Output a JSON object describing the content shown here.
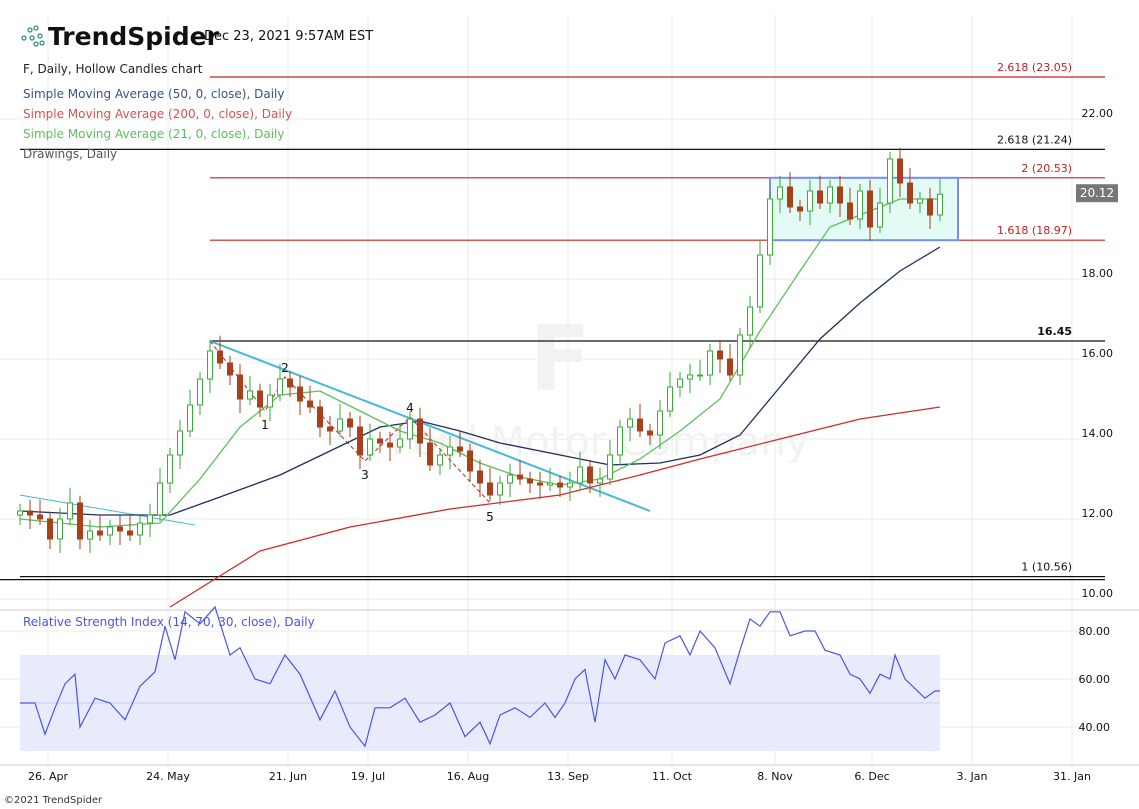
{
  "header": {
    "brand": "TrendSpider",
    "timestamp": "Dec 23, 2021 9:57AM EST",
    "footer": "©2021 TrendSpider"
  },
  "legend": {
    "main": "F, Daily, Hollow Candles chart",
    "sma50": "Simple Moving Average (50, 0, close), Daily",
    "sma200": "Simple Moving Average (200, 0, close), Daily",
    "sma21": "Simple Moving Average (21, 0, close), Daily",
    "drawings": "Drawings, Daily",
    "rsi": "Relative Strength Index (14, 70, 30, close), Daily"
  },
  "watermark": {
    "symbol": "F",
    "name": "Ford Motor Company"
  },
  "colors": {
    "up": "#3aaa3a",
    "down": "#a8401c",
    "sma50": "#1f2f5a",
    "sma200": "#d02a2a",
    "sma21": "#5cbf5c",
    "trend": "#45b8d8",
    "fib_red": "#c62020",
    "rsi": "#4a55e8",
    "rect_fill": "#ddfaf2",
    "rect_stroke": "#7a8cf5"
  },
  "chart_data": {
    "type": "candlestick",
    "symbol": "F",
    "interval": "Daily",
    "price_axis": {
      "ticks": [
        "22.00",
        "18.00",
        "16.00",
        "14.00",
        "12.00",
        "10.00"
      ],
      "tick_values": [
        22,
        18,
        16,
        14,
        12,
        10
      ],
      "range": [
        9.7,
        24
      ],
      "last_price": "20.12"
    },
    "time_axis": {
      "labels": [
        "26. Apr",
        "24. May",
        "21. Jun",
        "19. Jul",
        "16. Aug",
        "13. Sep",
        "11. Oct",
        "8. Nov",
        "6. Dec",
        "3. Jan",
        "31. Jan"
      ],
      "positions": [
        2.8,
        14.8,
        26.8,
        34.8,
        44.8,
        54.8,
        65.2,
        75.5,
        85.2,
        95.2,
        105.2
      ]
    },
    "closes": [
      12.2,
      12.1,
      12.0,
      11.5,
      12.0,
      12.4,
      11.5,
      11.7,
      11.6,
      11.8,
      11.7,
      11.6,
      11.9,
      12.1,
      12.9,
      13.6,
      14.2,
      14.85,
      15.5,
      16.2,
      15.9,
      15.6,
      15.0,
      15.2,
      14.8,
      15.1,
      15.5,
      15.3,
      14.95,
      14.8,
      14.3,
      14.2,
      14.5,
      14.3,
      13.6,
      14.0,
      13.9,
      13.8,
      14.0,
      14.5,
      13.9,
      13.35,
      13.6,
      13.8,
      13.7,
      13.2,
      12.9,
      12.6,
      12.9,
      13.1,
      13.0,
      12.9,
      12.85,
      12.9,
      12.8,
      12.9,
      13.3,
      12.9,
      13.0,
      13.6,
      14.3,
      14.5,
      14.2,
      14.1,
      14.7,
      15.3,
      15.5,
      15.6,
      15.6,
      16.2,
      16.0,
      15.6,
      16.6,
      17.3,
      18.6,
      20.0,
      20.3,
      19.8,
      19.7,
      20.2,
      19.9,
      20.3,
      19.9,
      19.5,
      20.2,
      19.3,
      19.9,
      21.0,
      20.4,
      19.9,
      20.0,
      19.6,
      20.12
    ],
    "sma50": [
      [
        0,
        12.2
      ],
      [
        8,
        12.1
      ],
      [
        15,
        12.1
      ],
      [
        20,
        12.55
      ],
      [
        26,
        13.1
      ],
      [
        31,
        13.7
      ],
      [
        36,
        14.3
      ],
      [
        40,
        14.45
      ],
      [
        44,
        14.2
      ],
      [
        48,
        13.9
      ],
      [
        54,
        13.6
      ],
      [
        59,
        13.35
      ],
      [
        64,
        13.4
      ],
      [
        68,
        13.6
      ],
      [
        72,
        14.1
      ],
      [
        76,
        15.3
      ],
      [
        80,
        16.5
      ],
      [
        84,
        17.4
      ],
      [
        88,
        18.2
      ],
      [
        92,
        18.8
      ]
    ],
    "sma21": [
      [
        0,
        12.0
      ],
      [
        8,
        11.8
      ],
      [
        14,
        11.9
      ],
      [
        18,
        13.0
      ],
      [
        22,
        14.3
      ],
      [
        26,
        15.1
      ],
      [
        30,
        15.2
      ],
      [
        34,
        14.7
      ],
      [
        38,
        14.2
      ],
      [
        42,
        13.9
      ],
      [
        46,
        13.4
      ],
      [
        50,
        13.05
      ],
      [
        54,
        12.85
      ],
      [
        58,
        13.0
      ],
      [
        62,
        13.5
      ],
      [
        66,
        14.2
      ],
      [
        70,
        15.0
      ],
      [
        74,
        16.7
      ],
      [
        78,
        18.2
      ],
      [
        81,
        19.3
      ],
      [
        85,
        19.7
      ],
      [
        88,
        20.0
      ],
      [
        92,
        20.0
      ]
    ],
    "sma200": [
      [
        15,
        9.8
      ],
      [
        24,
        11.2
      ],
      [
        33,
        11.8
      ],
      [
        43,
        12.25
      ],
      [
        54,
        12.6
      ],
      [
        62,
        13.1
      ],
      [
        68,
        13.5
      ],
      [
        76,
        14.0
      ],
      [
        84,
        14.5
      ],
      [
        92,
        14.8
      ]
    ],
    "fib_levels": [
      {
        "label": "2.618 (23.05)",
        "value": 23.05,
        "color": "red",
        "from": 19
      },
      {
        "label": "2.618 (21.24)",
        "value": 21.24,
        "color": "black",
        "from": 0
      },
      {
        "label": "2 (20.53)",
        "value": 20.53,
        "color": "red",
        "from": 19
      },
      {
        "label": "1.618 (18.97)",
        "value": 18.97,
        "color": "red",
        "from": 19
      },
      {
        "label": "16.45",
        "value": 16.45,
        "color": "black",
        "from": 19
      },
      {
        "label": "1 (10.56)",
        "value": 10.56,
        "color": "black",
        "from": 0
      }
    ],
    "range_box": {
      "from": 75,
      "to": 93.8,
      "top": 20.53,
      "bottom": 18.97
    },
    "trendlines": [
      [
        [
          19,
          16.45
        ],
        [
          63,
          12.2
        ]
      ],
      [
        [
          0,
          12.6
        ],
        [
          17.5,
          11.85
        ]
      ]
    ],
    "wave": {
      "points": [
        [
          19,
          16.45
        ],
        [
          24.5,
          14.7
        ],
        [
          26.5,
          15.55
        ],
        [
          34.5,
          13.45
        ],
        [
          39,
          14.55
        ],
        [
          47,
          12.4
        ]
      ],
      "labels": [
        "1",
        "2",
        "3",
        "4",
        "5"
      ],
      "label_offsets": [
        1,
        -1,
        1,
        -1,
        1
      ]
    },
    "rsi": {
      "range": [
        25,
        90
      ],
      "ticks": [
        "80.00",
        "60.00",
        "40.00"
      ],
      "tick_values": [
        80,
        60,
        40
      ],
      "band": [
        30,
        70
      ],
      "mid": 50,
      "values": [
        [
          0,
          50
        ],
        [
          1.5,
          50
        ],
        [
          2.5,
          37
        ],
        [
          3.5,
          48
        ],
        [
          4.5,
          58
        ],
        [
          5.5,
          62
        ],
        [
          6,
          40
        ],
        [
          7.5,
          52
        ],
        [
          9,
          50
        ],
        [
          10.5,
          43
        ],
        [
          12,
          57
        ],
        [
          13.5,
          63
        ],
        [
          14.5,
          82
        ],
        [
          15.5,
          68
        ],
        [
          16.5,
          88
        ],
        [
          18,
          83
        ],
        [
          19.5,
          90
        ],
        [
          21,
          70
        ],
        [
          22,
          73
        ],
        [
          23.5,
          60
        ],
        [
          25,
          58
        ],
        [
          26.5,
          70
        ],
        [
          28,
          62
        ],
        [
          30,
          43
        ],
        [
          31.5,
          55
        ],
        [
          33,
          40
        ],
        [
          34.5,
          32
        ],
        [
          35.5,
          48
        ],
        [
          37,
          48
        ],
        [
          38.5,
          52
        ],
        [
          40,
          42
        ],
        [
          41.5,
          45
        ],
        [
          43,
          50
        ],
        [
          44.5,
          36
        ],
        [
          46,
          42
        ],
        [
          47,
          33
        ],
        [
          48,
          45
        ],
        [
          49.5,
          48
        ],
        [
          51,
          44
        ],
        [
          52.5,
          50
        ],
        [
          53.5,
          44
        ],
        [
          54.5,
          50
        ],
        [
          55.5,
          60
        ],
        [
          56.5,
          64
        ],
        [
          57.5,
          42
        ],
        [
          58.5,
          68
        ],
        [
          59.5,
          60
        ],
        [
          60.5,
          70
        ],
        [
          62,
          68
        ],
        [
          63.5,
          60
        ],
        [
          64.5,
          75
        ],
        [
          66,
          78
        ],
        [
          67,
          70
        ],
        [
          68,
          80
        ],
        [
          69.5,
          73
        ],
        [
          71,
          58
        ],
        [
          72,
          72
        ],
        [
          73,
          85
        ],
        [
          74,
          82
        ],
        [
          75,
          88
        ],
        [
          76,
          88
        ],
        [
          77,
          78
        ],
        [
          78.5,
          80
        ],
        [
          79.5,
          80
        ],
        [
          80.5,
          72
        ],
        [
          82,
          70
        ],
        [
          83,
          62
        ],
        [
          84,
          60
        ],
        [
          85,
          54
        ],
        [
          86,
          62
        ],
        [
          87,
          60
        ],
        [
          87.5,
          70
        ],
        [
          88.5,
          60
        ],
        [
          89.5,
          56
        ],
        [
          90.5,
          52
        ],
        [
          91.5,
          55
        ],
        [
          92,
          55
        ]
      ]
    }
  }
}
